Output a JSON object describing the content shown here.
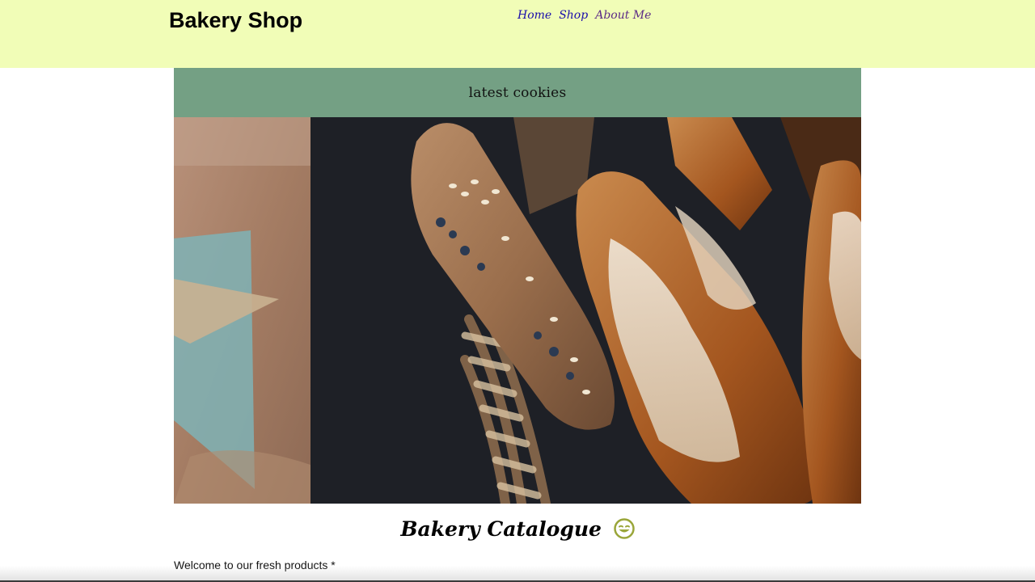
{
  "header": {
    "title": "Bakery Shop",
    "nav": [
      {
        "label": "Home"
      },
      {
        "label": "Shop"
      },
      {
        "label": "About Me"
      }
    ],
    "background": "#f1fdb7"
  },
  "banner": {
    "text": "latest cookies",
    "background": "#74a084"
  },
  "hero": {
    "icon": "bread-basket-photo"
  },
  "main": {
    "catalogue_title": "Bakery Catalogue",
    "catalogue_emoji": "smiley-wink-icon",
    "welcome_text": "Welcome to our fresh products *"
  }
}
